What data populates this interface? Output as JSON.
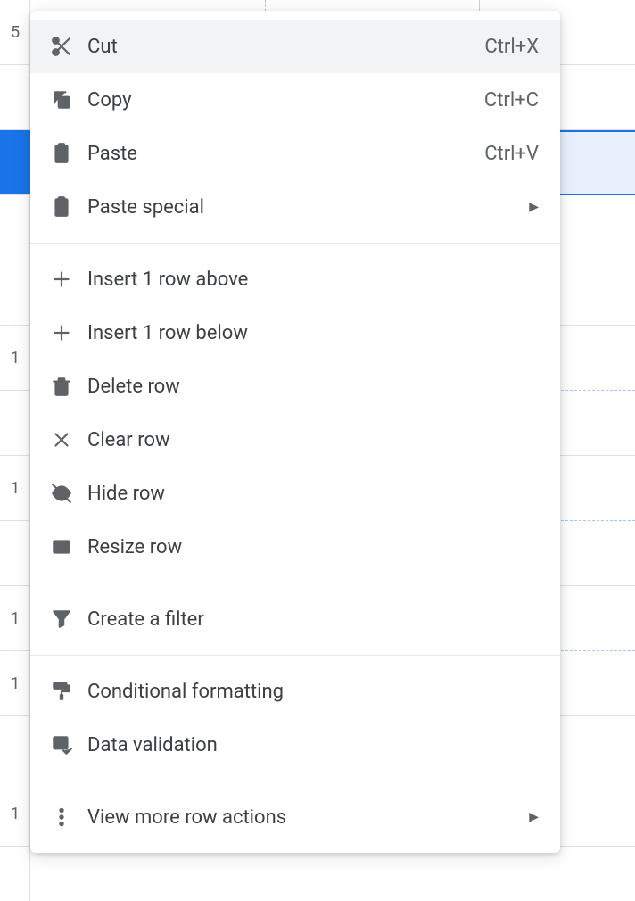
{
  "menu": {
    "items": [
      {
        "id": "cut",
        "label": "Cut",
        "shortcut": "Ctrl+X",
        "icon": "scissors",
        "hovered": true
      },
      {
        "id": "copy",
        "label": "Copy",
        "shortcut": "Ctrl+C",
        "icon": "copy"
      },
      {
        "id": "paste",
        "label": "Paste",
        "shortcut": "Ctrl+V",
        "icon": "clipboard"
      },
      {
        "id": "paste-special",
        "label": "Paste special",
        "icon": "clipboard",
        "submenu": true
      },
      {
        "separator": true
      },
      {
        "id": "insert-above",
        "label": "Insert 1 row above",
        "icon": "plus"
      },
      {
        "id": "insert-below",
        "label": "Insert 1 row below",
        "icon": "plus"
      },
      {
        "id": "delete-row",
        "label": "Delete row",
        "icon": "trash"
      },
      {
        "id": "clear-row",
        "label": "Clear row",
        "icon": "close"
      },
      {
        "id": "hide-row",
        "label": "Hide row",
        "icon": "eye-off"
      },
      {
        "id": "resize-row",
        "label": "Resize row",
        "icon": "resize"
      },
      {
        "separator": true
      },
      {
        "id": "create-filter",
        "label": "Create a filter",
        "icon": "filter"
      },
      {
        "separator": true
      },
      {
        "id": "conditional-formatting",
        "label": "Conditional formatting",
        "icon": "paint-roller"
      },
      {
        "id": "data-validation",
        "label": "Data validation",
        "icon": "checklist"
      },
      {
        "separator": true
      },
      {
        "id": "more-actions",
        "label": "View more row actions",
        "icon": "dots-vertical",
        "submenu": true
      }
    ]
  },
  "sheet": {
    "visibleRowHeaders": [
      "5",
      "",
      "",
      "",
      "",
      "1",
      "",
      "1",
      "",
      "1",
      "1",
      "",
      "1"
    ],
    "selectedIndex": 2
  }
}
